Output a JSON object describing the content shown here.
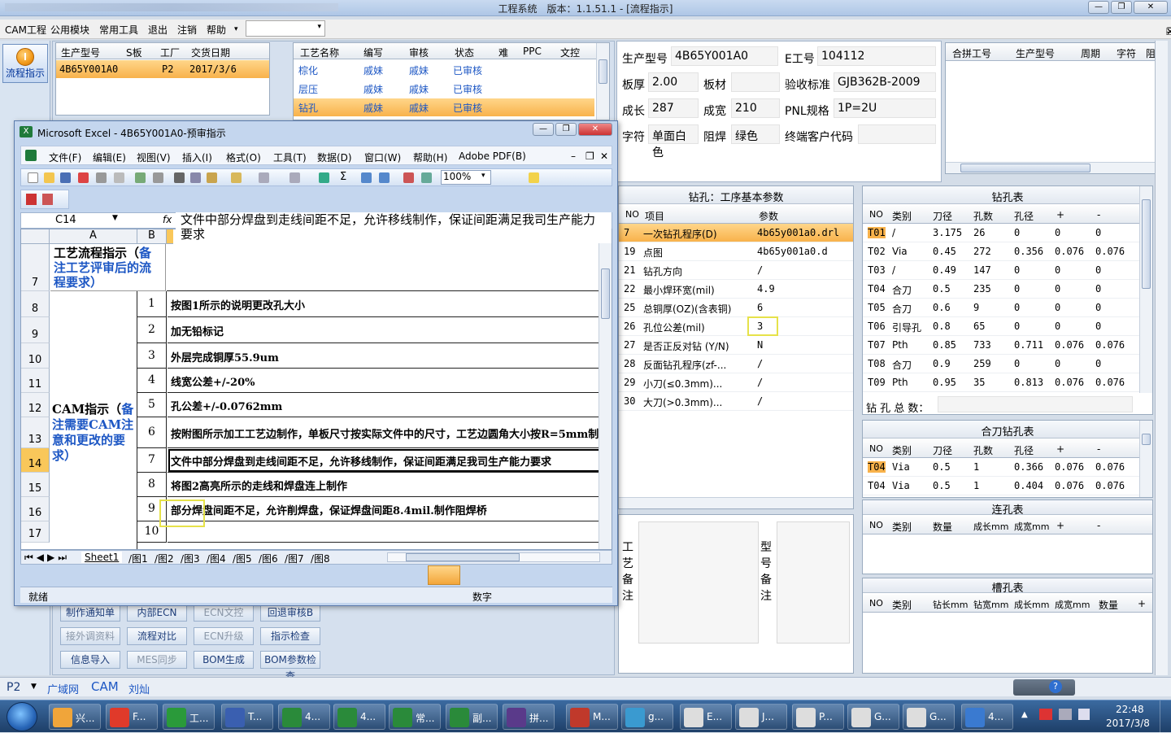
{
  "app": {
    "title": "工程系统　版本：1.1.51.1 - [流程指示]"
  },
  "menu": [
    "CAM工程",
    "公用模块",
    "常用工具",
    "退出",
    "注销",
    "帮助"
  ],
  "left": {
    "flow_label": "流程指示"
  },
  "prod": {
    "headers": [
      "生产型号",
      "S板",
      "工厂",
      "交货日期"
    ],
    "row": [
      "4B65Y001A0",
      "",
      "P2",
      "2017/3/6"
    ]
  },
  "proc": {
    "headers": [
      "工艺名称",
      "编写",
      "审核",
      "状态",
      "难",
      "PPC",
      "文控"
    ],
    "rows": [
      [
        "棕化",
        "戚妹",
        "戚妹",
        "已审核"
      ],
      [
        "层压",
        "戚妹",
        "戚妹",
        "已审核"
      ],
      [
        "钻孔",
        "戚妹",
        "戚妹",
        "已审核"
      ]
    ]
  },
  "info": {
    "l1": "生产型号",
    "v1": "4B65Y001A0",
    "l2": "E工号",
    "v2": "104112",
    "l3": "板厚",
    "v3": "2.00",
    "l4": "板材",
    "v4": "",
    "l5": "验收标准",
    "v5": "GJB362B-2009",
    "l6": "成长",
    "v6": "287",
    "l7": "成宽",
    "v7": "210",
    "l8": "PNL规格",
    "v8": "1P=2U",
    "l9": "字符",
    "v9": "单面白色",
    "l10": "阻焊",
    "v10": "绿色",
    "l11": "终端客户代码",
    "v11": ""
  },
  "merge": {
    "headers": [
      "合拼工号",
      "生产型号",
      "周期",
      "字符",
      "阻焊"
    ]
  },
  "params": {
    "title": "钻孔：工序基本参数",
    "headers": [
      "NO",
      "项目",
      "参数"
    ],
    "rows": [
      [
        "7",
        "一次钻孔程序(D)",
        "4b65y001a0.drl"
      ],
      [
        "19",
        "点图",
        "4b65y001a0.d"
      ],
      [
        "21",
        "钻孔方向",
        "/"
      ],
      [
        "22",
        "最小焊环宽(mil)",
        "4.9"
      ],
      [
        "25",
        "总铜厚(OZ)(含表铜)",
        "6"
      ],
      [
        "26",
        "孔位公差(mil)",
        "3"
      ],
      [
        "27",
        "是否正反对钻 (Y/N)",
        "N"
      ],
      [
        "28",
        "反面钻孔程序(zf-...",
        "/"
      ],
      [
        "29",
        "小刀(≤0.3mm)...",
        "/"
      ],
      [
        "30",
        "大刀(>0.3mm)...",
        "/"
      ]
    ]
  },
  "drill": {
    "title": "钻孔表",
    "headers": [
      "NO",
      "类别",
      "刀径",
      "孔数",
      "孔径",
      "+",
      "-"
    ],
    "rows": [
      [
        "T01",
        "/",
        "3.175",
        "26",
        "0",
        "0",
        "0"
      ],
      [
        "T02",
        "Via",
        "0.45",
        "272",
        "0.356",
        "0.076",
        "0.076"
      ],
      [
        "T03",
        "/",
        "0.49",
        "147",
        "0",
        "0",
        "0"
      ],
      [
        "T04",
        "合刀",
        "0.5",
        "235",
        "0",
        "0",
        "0"
      ],
      [
        "T05",
        "合刀",
        "0.6",
        "9",
        "0",
        "0",
        "0"
      ],
      [
        "T06",
        "引导孔",
        "0.8",
        "65",
        "0",
        "0",
        "0"
      ],
      [
        "T07",
        "Pth",
        "0.85",
        "733",
        "0.711",
        "0.076",
        "0.076"
      ],
      [
        "T08",
        "合刀",
        "0.9",
        "259",
        "0",
        "0",
        "0"
      ],
      [
        "T09",
        "Pth",
        "0.95",
        "35",
        "0.813",
        "0.076",
        "0.076"
      ]
    ],
    "total_label": "钻 孔 总 数："
  },
  "merge_drill": {
    "title": "合刀钻孔表",
    "headers": [
      "NO",
      "类别",
      "刀径",
      "孔数",
      "孔径",
      "+",
      "-"
    ],
    "rows": [
      [
        "T04",
        "Via",
        "0.5",
        "1",
        "0.366",
        "0.076",
        "0.076"
      ],
      [
        "T04",
        "Via",
        "0.5",
        "1",
        "0.404",
        "0.076",
        "0.076"
      ]
    ]
  },
  "slot": {
    "title": "连孔表",
    "headers": [
      "NO",
      "类别",
      "数量",
      "成长mm",
      "成宽mm",
      "+",
      "-"
    ]
  },
  "groove": {
    "title": "槽孔表",
    "headers": [
      "NO",
      "类别",
      "钻长mm",
      "钻宽mm",
      "成长mm",
      "成宽mm",
      "数量",
      "+"
    ]
  },
  "notes": {
    "proc_label": "工艺备注",
    "model_label": "型号备注"
  },
  "buttons": {
    "r1": [
      "制作通知单",
      "内部ECN",
      "ECN文控",
      "回退审核B"
    ],
    "r2": [
      "接外调资料",
      "流程对比",
      "ECN升级",
      "指示检查"
    ],
    "r3": [
      "信息导入",
      "MES同步",
      "BOM生成",
      "BOM参数检查"
    ]
  },
  "excel": {
    "title": "Microsoft Excel - 4B65Y001A0-预审指示",
    "menu": [
      "文件(F)",
      "编辑(E)",
      "视图(V)",
      "插入(I)",
      "格式(O)",
      "工具(T)",
      "数据(D)",
      "窗口(W)",
      "帮助(H)",
      "Adobe PDF(B)"
    ],
    "zoom": "100%",
    "namebox": "C14",
    "formula": "文件中部分焊盘到走线间距不足，允许移线制作，保证间距满足我司生产能力要求",
    "colA": "A",
    "colB": "B",
    "row7_text": "工艺流程指示（",
    "row7_blue": "备注工艺评审后的流程要求）",
    "cam_text": "CAM指示（",
    "cam_blue": "备注需要CAM注意和更改的要求）",
    "rows": [
      {
        "r": "8",
        "n": "1",
        "t": "按图1所示的说明更改孔大小"
      },
      {
        "r": "9",
        "n": "2",
        "t": "加无铅标记"
      },
      {
        "r": "10",
        "n": "3",
        "t": "外层完成铜厚55.9um"
      },
      {
        "r": "11",
        "n": "4",
        "t": "线宽公差+/-20%"
      },
      {
        "r": "12",
        "n": "5",
        "t": "孔公差+/-0.0762mm"
      },
      {
        "r": "13",
        "n": "6",
        "t": "按附图所示加工工艺边制作，单板尺寸按实际文件中的尺寸，工艺边圆角大小按R=5mm制"
      },
      {
        "r": "14",
        "n": "7",
        "t": "文件中部分焊盘到走线间距不足，允许移线制作，保证间距满足我司生产能力要求"
      },
      {
        "r": "15",
        "n": "8",
        "t": "将图2高亮所示的走线和焊盘连上制作"
      },
      {
        "r": "16",
        "n": "9",
        "t": "部分焊盘间距不足，允许削焊盘，保证焊盘间距8.4mil.制作阻焊桥"
      },
      {
        "r": "17",
        "n": "10",
        "t": ""
      }
    ],
    "row7": "7",
    "tabs": [
      "Sheet1",
      "图1",
      "图2",
      "图3",
      "图4",
      "图5",
      "图6",
      "图7",
      "图8"
    ],
    "status": "就绪",
    "status_right": "数字"
  },
  "statusbar": {
    "p2": "P2",
    "items": [
      "广域网",
      "CAM",
      "刘灿"
    ]
  },
  "taskbar": {
    "apps": [
      "兴...",
      "F...",
      "工...",
      "T...",
      "4...",
      "4...",
      "常...",
      "副...",
      "拼...",
      "M...",
      "g...",
      "E...",
      "J...",
      "P...",
      "G...",
      "G...",
      "4..."
    ],
    "time": "22:48",
    "date": "2017/3/8"
  }
}
